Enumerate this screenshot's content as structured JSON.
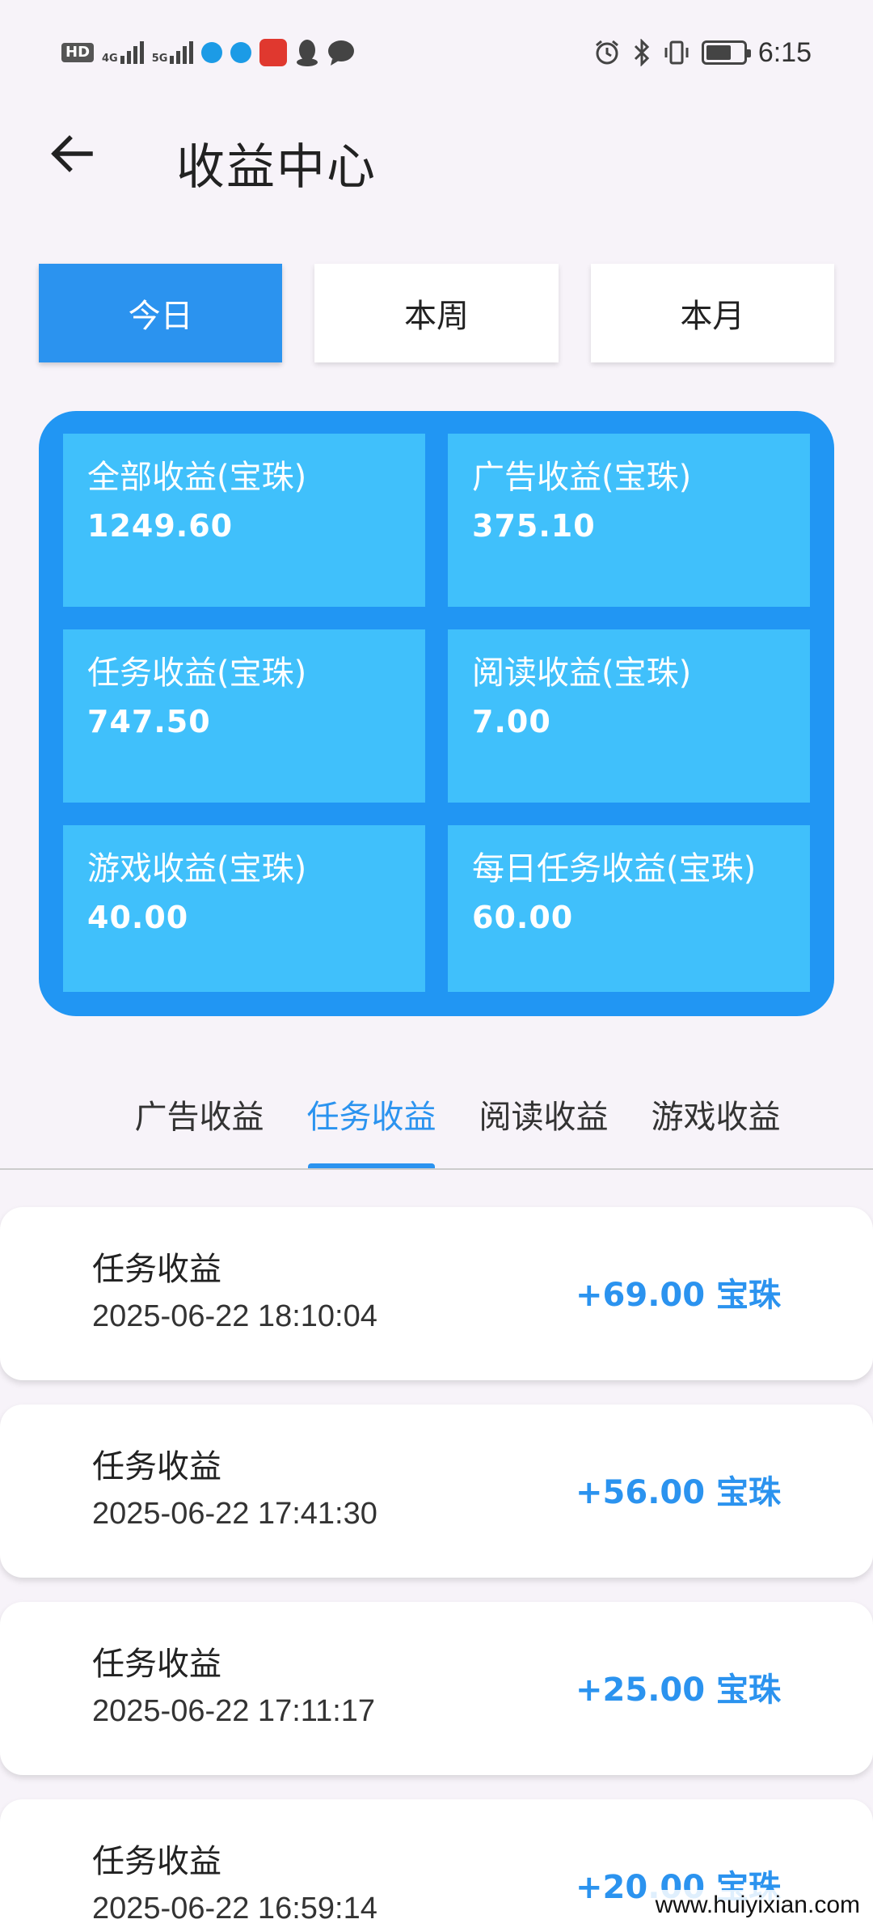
{
  "status_bar": {
    "hd": "HD",
    "net1": "4G",
    "net2": "5G",
    "time": "6:15",
    "left_icons": [
      "signal-4g-icon",
      "signal-5g-icon",
      "app-notify-icon",
      "app-notify-icon",
      "huawei-app-icon",
      "qq-icon",
      "message-icon"
    ],
    "right_icons": [
      "alarm-icon",
      "bluetooth-icon",
      "vibrate-icon",
      "battery-icon"
    ]
  },
  "header": {
    "title": "收益中心",
    "back_icon": "arrow-left-icon"
  },
  "period_tabs": [
    {
      "label": "今日",
      "active": true
    },
    {
      "label": "本周",
      "active": false
    },
    {
      "label": "本月",
      "active": false
    }
  ],
  "stats": [
    {
      "label": "全部收益(宝珠)",
      "value": "1249.60"
    },
    {
      "label": "广告收益(宝珠)",
      "value": "375.10"
    },
    {
      "label": "任务收益(宝珠)",
      "value": "747.50"
    },
    {
      "label": "阅读收益(宝珠)",
      "value": "7.00"
    },
    {
      "label": "游戏收益(宝珠)",
      "value": "40.00"
    },
    {
      "label": "每日任务收益(宝珠)",
      "value": "60.00"
    }
  ],
  "category_tabs": [
    {
      "label": "广告收益",
      "active": false
    },
    {
      "label": "任务收益",
      "active": true
    },
    {
      "label": "阅读收益",
      "active": false
    },
    {
      "label": "游戏收益",
      "active": false
    }
  ],
  "records": [
    {
      "title": "任务收益",
      "time": "2025-06-22 18:10:04",
      "amount": "+69.00 宝珠"
    },
    {
      "title": "任务收益",
      "time": "2025-06-22 17:41:30",
      "amount": "+56.00 宝珠"
    },
    {
      "title": "任务收益",
      "time": "2025-06-22 17:11:17",
      "amount": "+25.00 宝珠"
    },
    {
      "title": "任务收益",
      "time": "2025-06-22 16:59:14",
      "amount": "+20.00 宝珠"
    }
  ],
  "watermark": "www.huiyixian.com",
  "colors": {
    "accent": "#2b93ef",
    "panel": "#2196f3",
    "cell": "#40c0fb",
    "background": "#f7f3f9"
  }
}
